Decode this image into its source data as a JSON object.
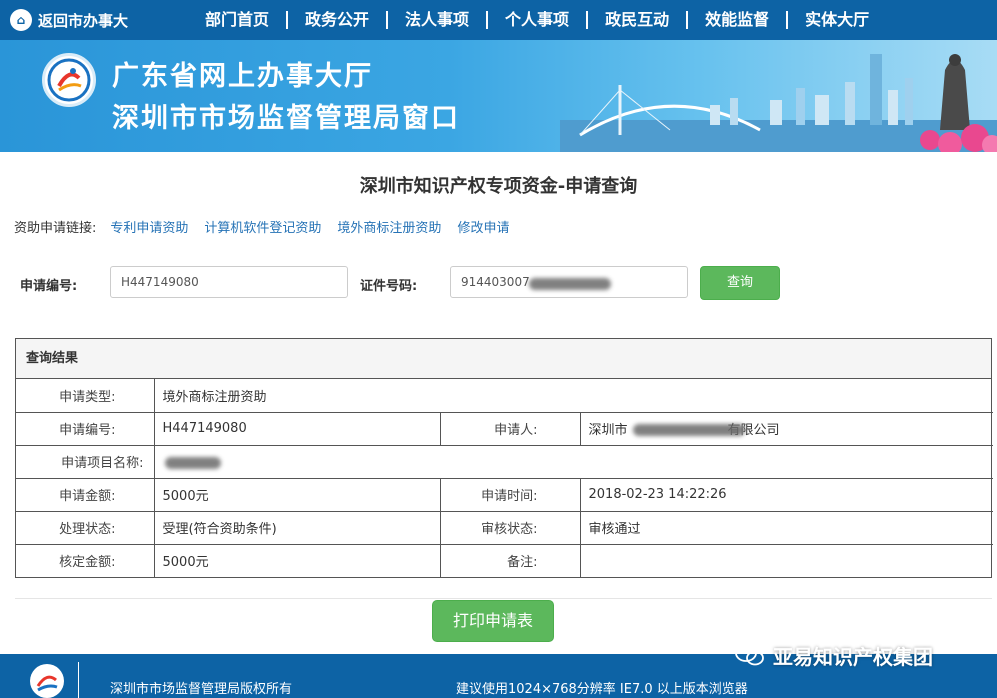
{
  "topnav": {
    "back_label": "返回市办事大",
    "items": [
      {
        "label": "部门首页"
      },
      {
        "label": "政务公开"
      },
      {
        "label": "法人事项"
      },
      {
        "label": "个人事项"
      },
      {
        "label": "政民互动"
      },
      {
        "label": "效能监督"
      },
      {
        "label": "实体大厅"
      }
    ]
  },
  "banner": {
    "line1": "广东省网上办事大厅",
    "line2": "深圳市市场监督管理局窗口"
  },
  "page_title": "深圳市知识产权专项资金-申请查询",
  "links": {
    "label": "资助申请链接:",
    "items": [
      {
        "label": "专利申请资助"
      },
      {
        "label": "计算机软件登记资助"
      },
      {
        "label": "境外商标注册资助"
      },
      {
        "label": "修改申请"
      }
    ]
  },
  "search": {
    "app_no_label": "申请编号:",
    "app_no_value": "H447149080",
    "id_label": "证件号码:",
    "id_value": "914403007",
    "query_label": "查询"
  },
  "results": {
    "title": "查询结果",
    "type_label": "申请类型:",
    "type_value": "境外商标注册资助",
    "no_label": "申请编号:",
    "no_value": "H447149080",
    "applicant_label": "申请人:",
    "applicant_prefix": "深圳市",
    "applicant_suffix": "有限公司",
    "project_label": "申请项目名称:",
    "project_value": "",
    "amount_label": "申请金额:",
    "amount_value": "5000元",
    "time_label": "申请时间:",
    "time_value": "2018-02-23 14:22:26",
    "status_label": "处理状态:",
    "status_value": "受理(符合资助条件)",
    "review_label": "审核状态:",
    "review_value": "审核通过",
    "approved_label": "核定金额:",
    "approved_value": "5000元",
    "remark_label": "备注:",
    "remark_value": ""
  },
  "print_label": "打印申请表",
  "footer": {
    "copyright": "深圳市市场监督管理局版权所有",
    "note": "建议使用1024×768分辨率 IE7.0 以上版本浏览器"
  },
  "watermark": "亚易知识产权集团",
  "colors": {
    "nav_blue": "#0d63a5",
    "button_green": "#5cb85c",
    "link_blue": "#2673b6"
  }
}
